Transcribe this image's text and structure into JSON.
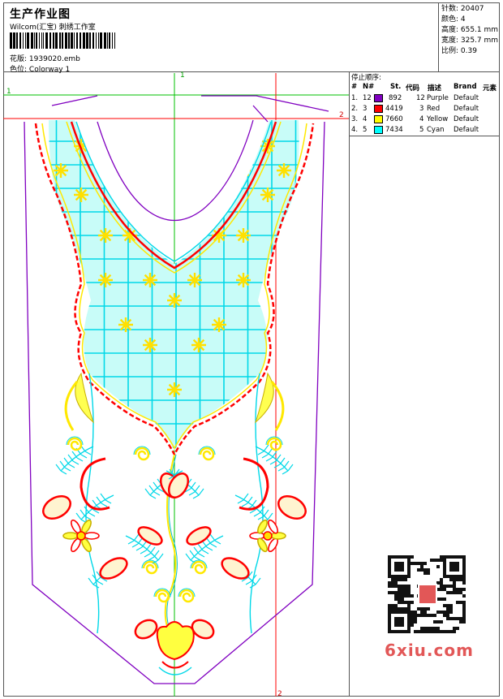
{
  "header": {
    "title": "生产作业图",
    "company": "Wilcom(汇宝) 刺绣工作室",
    "design_label": "花版:",
    "design_value": "1939020.emb",
    "colorway_label": "色位:",
    "colorway_value": "Colorway 1"
  },
  "stats": {
    "stitches": "针数: 20407",
    "colors": "颜色: 4",
    "height": "高度: 655.1 mm",
    "width": "宽度: 325.7 mm",
    "scale": "比例: 0.39"
  },
  "stops": {
    "title": "停止顺序:",
    "headers": [
      "#",
      "N#",
      "St.",
      "代码",
      "描述",
      "Brand",
      "元素"
    ],
    "rows": [
      {
        "idx": "1.",
        "n": "12",
        "color": "#8000c0",
        "st": "892",
        "code": "12",
        "desc": "Purple",
        "brand": "Default"
      },
      {
        "idx": "2.",
        "n": "3",
        "color": "#ff0000",
        "st": "4419",
        "code": "3",
        "desc": "Red",
        "brand": "Default"
      },
      {
        "idx": "3.",
        "n": "4",
        "color": "#ffff00",
        "st": "7660",
        "code": "4",
        "desc": "Yellow",
        "brand": "Default"
      },
      {
        "idx": "4.",
        "n": "5",
        "color": "#00ffff",
        "st": "7434",
        "code": "5",
        "desc": "Cyan",
        "brand": "Default"
      }
    ]
  },
  "rulers": {
    "v1": "1",
    "h1": "1",
    "h2": "2",
    "v2": "2"
  },
  "colors": {
    "purple": "#8000c0",
    "red": "#ff0000",
    "yellow": "#ffff00",
    "cyan": "#00ffff",
    "green": "#00c000"
  },
  "watermark": "6xiu.com"
}
